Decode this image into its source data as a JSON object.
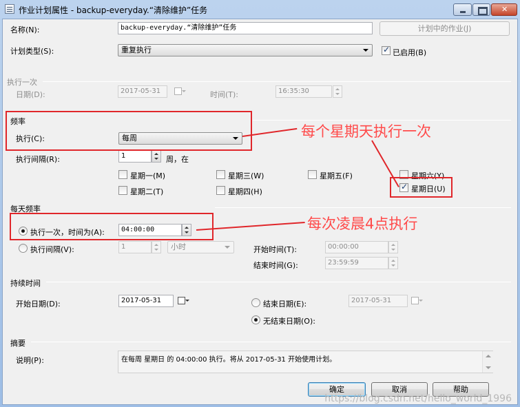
{
  "window": {
    "title": "作业计划属性 - backup-everyday.“清除维护”任务"
  },
  "name_row": {
    "label": "名称(N):",
    "value": "backup-everyday.“清除维护”任务",
    "jobs_button": "计划中的作业(J)"
  },
  "schedule_type": {
    "label": "计划类型(S):",
    "value": "重复执行",
    "enabled_label": "已启用(B)"
  },
  "one_time": {
    "header": "执行一次",
    "date_label": "日期(D):",
    "date_value": "2017-05-31",
    "time_label": "时间(T):",
    "time_value": "16:35:30"
  },
  "frequency": {
    "header": "频率",
    "occurs_label": "执行(C):",
    "occurs_value": "每周",
    "recurs_label": "执行间隔(R):",
    "recurs_value": "1",
    "recurs_suffix": "周，在",
    "days": [
      {
        "label": "星期一(M)",
        "checked": false
      },
      {
        "label": "星期二(T)",
        "checked": false
      },
      {
        "label": "星期三(W)",
        "checked": false
      },
      {
        "label": "星期四(H)",
        "checked": false
      },
      {
        "label": "星期五(F)",
        "checked": false
      },
      {
        "label": "星期六(Y)",
        "checked": false
      },
      {
        "label": "星期日(U)",
        "checked": true
      }
    ]
  },
  "daily": {
    "header": "每天频率",
    "once_label": "执行一次，时间为(A):",
    "once_value": "04:00:00",
    "every_label": "执行间隔(V):",
    "every_value": "1",
    "every_unit": "小时",
    "start_label": "开始时间(T):",
    "start_value": "00:00:00",
    "end_label": "结束时间(G):",
    "end_value": "23:59:59"
  },
  "duration": {
    "header": "持续时间",
    "start_label": "开始日期(D):",
    "start_value": "2017-05-31",
    "end_label": "结束日期(E):",
    "end_value": "2017-05-31",
    "no_end_label": "无结束日期(O):"
  },
  "summary": {
    "header": "摘要",
    "desc_label": "说明(P):",
    "desc_value": "在每周 星期日 的 04:00:00 执行。将从 2017-05-31 开始使用计划。"
  },
  "buttons": {
    "ok": "确定",
    "cancel": "取消",
    "help": "帮助"
  },
  "annotations": {
    "weekly": "每个星期天执行一次",
    "daily": "每次凌晨4点执行"
  },
  "watermark": "https://blog.csdn.net/hello_world_1996",
  "colors": {
    "annotation": "#e0262a",
    "annotation_text": "#ff4a4a",
    "titlebar": "#bcd3ee",
    "client": "#f0f0f0"
  }
}
